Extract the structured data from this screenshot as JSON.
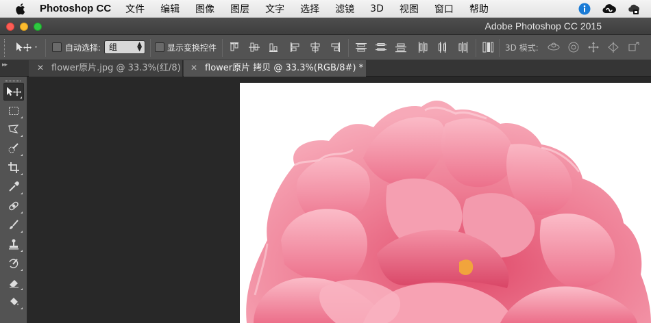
{
  "menubar": {
    "app_name": "Photoshop CC",
    "items": [
      "文件",
      "编辑",
      "图像",
      "图层",
      "文字",
      "选择",
      "滤镜",
      "3D",
      "视图",
      "窗口",
      "帮助"
    ],
    "right_icons": [
      "info-icon",
      "creative-cloud-icon",
      "cloud-sync-icon"
    ]
  },
  "window": {
    "title": "Adobe Photoshop CC 2015"
  },
  "options": {
    "auto_select_label": "自动选择:",
    "auto_select_checked": false,
    "auto_select_value": "组",
    "show_transform_label": "显示变换控件",
    "show_transform_checked": false,
    "mode_3d_label": "3D 模式:"
  },
  "tabs": [
    {
      "label": "flower原片.jpg @ 33.3%(红/8)",
      "active": false
    },
    {
      "label": "flower原片 拷贝 @ 33.3%(RGB/8#) *",
      "active": true
    }
  ],
  "colors": {
    "accent_info": "#1a7bd6",
    "petal_pink": "#f08aa0",
    "petal_deep": "#e45876"
  }
}
